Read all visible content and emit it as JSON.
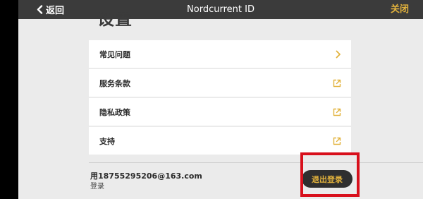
{
  "header": {
    "back_label": "返回",
    "title": "Nordcurrent ID",
    "close_label": "关闭"
  },
  "page": {
    "heading": "设置"
  },
  "menu": {
    "items": [
      {
        "label": "常见问题",
        "icon": "chevron-right-icon"
      },
      {
        "label": "服务条款",
        "icon": "external-link-icon"
      },
      {
        "label": "隐私政策",
        "icon": "external-link-icon"
      },
      {
        "label": "支持",
        "icon": "external-link-icon"
      }
    ]
  },
  "account": {
    "email": "用18755295206@163.com",
    "status": "登录",
    "logout_label": "退出登录"
  },
  "colors": {
    "accent": "#e2b23c",
    "header_bg": "#3b3b3b",
    "page_bg": "#ebebeb",
    "highlight": "#d8101c"
  }
}
